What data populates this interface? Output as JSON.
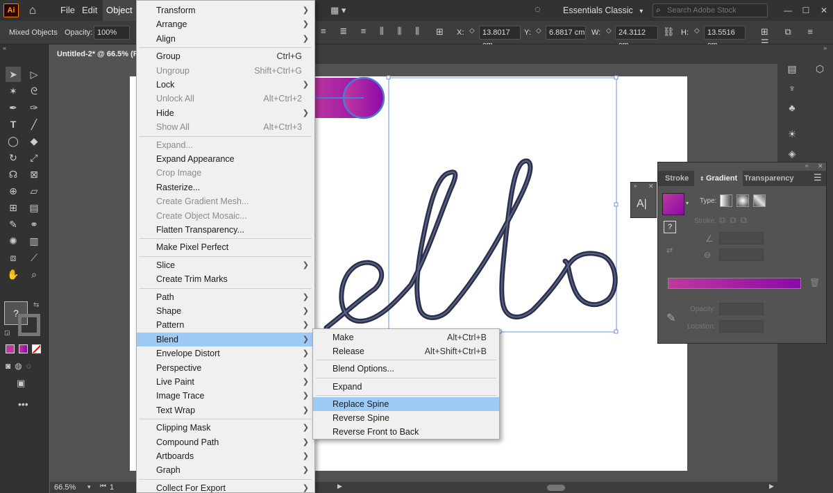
{
  "app": {
    "logo": "Ai",
    "window_title": "Untitled-2* @ 66.5% (R"
  },
  "menubar": {
    "items": [
      "File",
      "Edit",
      "Object"
    ],
    "active": "Object"
  },
  "workspace": {
    "name": "Essentials Classic",
    "search_placeholder": "Search Adobe Stock"
  },
  "control_bar": {
    "selection": "Mixed Objects",
    "opacity_label": "Opacity:",
    "opacity_value": "100%",
    "x_label": "X:",
    "x_value": "13.8017 cm",
    "y_label": "Y:",
    "y_value": "6.8817 cm",
    "w_label": "W:",
    "w_value": "24.3112 cm",
    "h_label": "H:",
    "h_value": "13.5516 cm"
  },
  "object_menu": [
    {
      "label": "Transform",
      "submenu": true
    },
    {
      "label": "Arrange",
      "submenu": true
    },
    {
      "label": "Align",
      "submenu": true
    },
    {
      "sep": true
    },
    {
      "label": "Group",
      "shortcut": "Ctrl+G"
    },
    {
      "label": "Ungroup",
      "shortcut": "Shift+Ctrl+G",
      "disabled": true
    },
    {
      "label": "Lock",
      "submenu": true
    },
    {
      "label": "Unlock All",
      "shortcut": "Alt+Ctrl+2",
      "disabled": true
    },
    {
      "label": "Hide",
      "submenu": true
    },
    {
      "label": "Show All",
      "shortcut": "Alt+Ctrl+3",
      "disabled": true
    },
    {
      "sep": true
    },
    {
      "label": "Expand...",
      "disabled": true
    },
    {
      "label": "Expand Appearance"
    },
    {
      "label": "Crop Image",
      "disabled": true
    },
    {
      "label": "Rasterize..."
    },
    {
      "label": "Create Gradient Mesh...",
      "disabled": true
    },
    {
      "label": "Create Object Mosaic...",
      "disabled": true
    },
    {
      "label": "Flatten Transparency..."
    },
    {
      "sep": true
    },
    {
      "label": "Make Pixel Perfect"
    },
    {
      "sep": true
    },
    {
      "label": "Slice",
      "submenu": true
    },
    {
      "label": "Create Trim Marks"
    },
    {
      "sep": true
    },
    {
      "label": "Path",
      "submenu": true
    },
    {
      "label": "Shape",
      "submenu": true
    },
    {
      "label": "Pattern",
      "submenu": true
    },
    {
      "label": "Blend",
      "submenu": true,
      "highlighted": true
    },
    {
      "label": "Envelope Distort",
      "submenu": true
    },
    {
      "label": "Perspective",
      "submenu": true
    },
    {
      "label": "Live Paint",
      "submenu": true
    },
    {
      "label": "Image Trace",
      "submenu": true
    },
    {
      "label": "Text Wrap",
      "submenu": true
    },
    {
      "sep": true
    },
    {
      "label": "Clipping Mask",
      "submenu": true
    },
    {
      "label": "Compound Path",
      "submenu": true
    },
    {
      "label": "Artboards",
      "submenu": true
    },
    {
      "label": "Graph",
      "submenu": true
    },
    {
      "sep": true
    },
    {
      "label": "Collect For Export",
      "submenu": true
    }
  ],
  "blend_submenu": [
    {
      "label": "Make",
      "shortcut": "Alt+Ctrl+B"
    },
    {
      "label": "Release",
      "shortcut": "Alt+Shift+Ctrl+B"
    },
    {
      "sep": true
    },
    {
      "label": "Blend Options..."
    },
    {
      "sep": true
    },
    {
      "label": "Expand"
    },
    {
      "sep": true
    },
    {
      "label": "Replace Spine",
      "highlighted": true
    },
    {
      "label": "Reverse Spine"
    },
    {
      "label": "Reverse Front to Back"
    }
  ],
  "gradient_panel": {
    "tabs": [
      "Stroke",
      "Gradient",
      "Transparency"
    ],
    "active_tab": "Gradient",
    "type_label": "Type:",
    "stroke_label": "Stroke:",
    "opacity_label": "Opacity:",
    "location_label": "Location:",
    "colors": {
      "start": "#c0399e",
      "end": "#8a0aa8"
    }
  },
  "status": {
    "zoom": "66.5%",
    "page": "1"
  },
  "canvas": {
    "stroke_color": "#2a2f4a",
    "selection_color": "#4a7bd8"
  }
}
